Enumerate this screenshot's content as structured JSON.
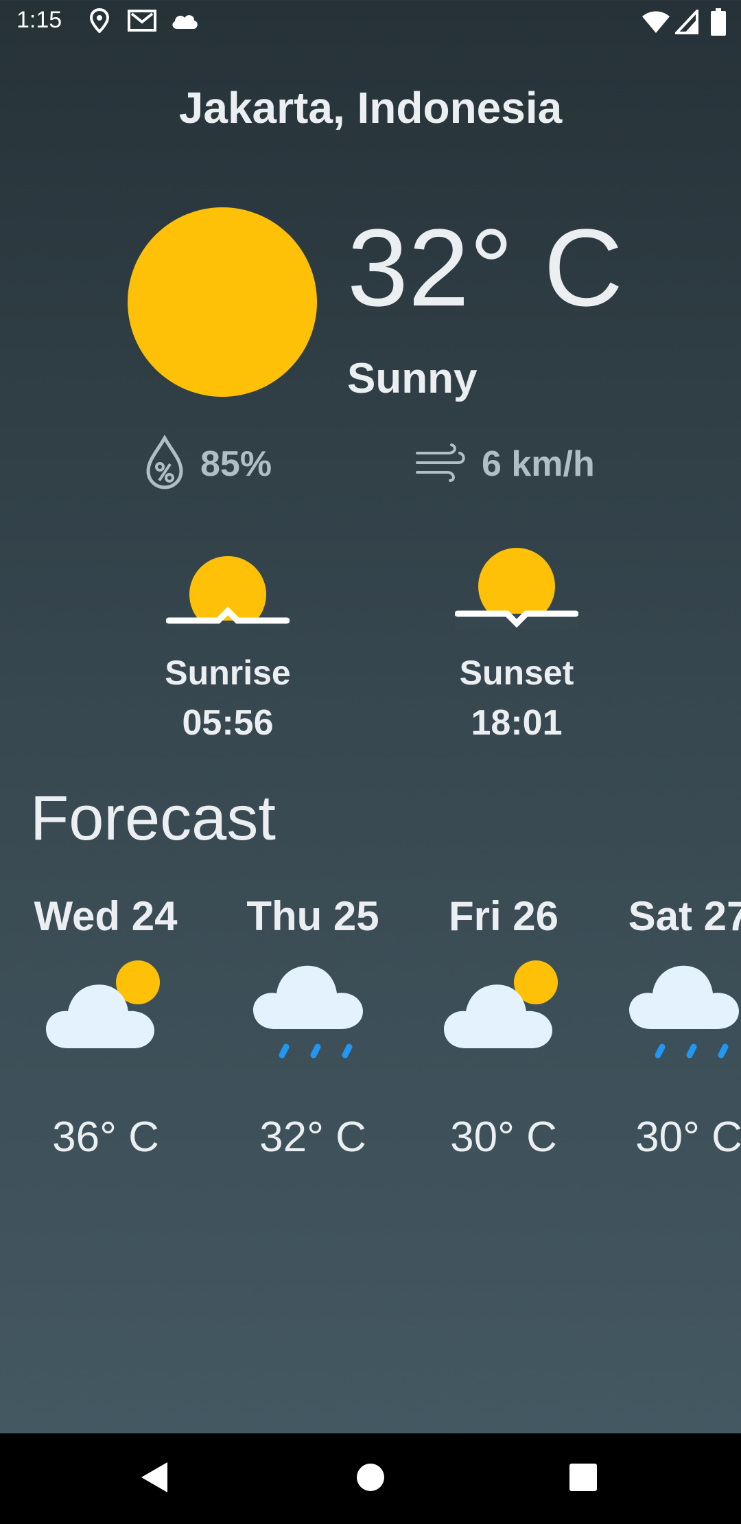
{
  "status_bar": {
    "time": "1:15"
  },
  "location": "Jakarta, Indonesia",
  "current": {
    "temperature": "32° C",
    "condition": "Sunny",
    "humidity": "85%",
    "wind": "6 km/h"
  },
  "sun": {
    "sunrise_label": "Sunrise",
    "sunrise_time": "05:56",
    "sunset_label": "Sunset",
    "sunset_time": "18:01"
  },
  "forecast": {
    "title": "Forecast",
    "days": [
      {
        "day": "Wed 24",
        "icon": "partly-cloudy-icon",
        "temp": "36° C"
      },
      {
        "day": "Thu 25",
        "icon": "rain-cloud-icon",
        "temp": "32° C"
      },
      {
        "day": "Fri 26",
        "icon": "partly-cloudy-icon",
        "temp": "30° C"
      },
      {
        "day": "Sat 27",
        "icon": "rain-cloud-icon",
        "temp": "30° C"
      }
    ]
  },
  "colors": {
    "sun": "#ffc107",
    "cloud": "#e3f2fd",
    "rain": "#2196f3",
    "background_top": "#263238",
    "background_bottom": "#455a64"
  }
}
